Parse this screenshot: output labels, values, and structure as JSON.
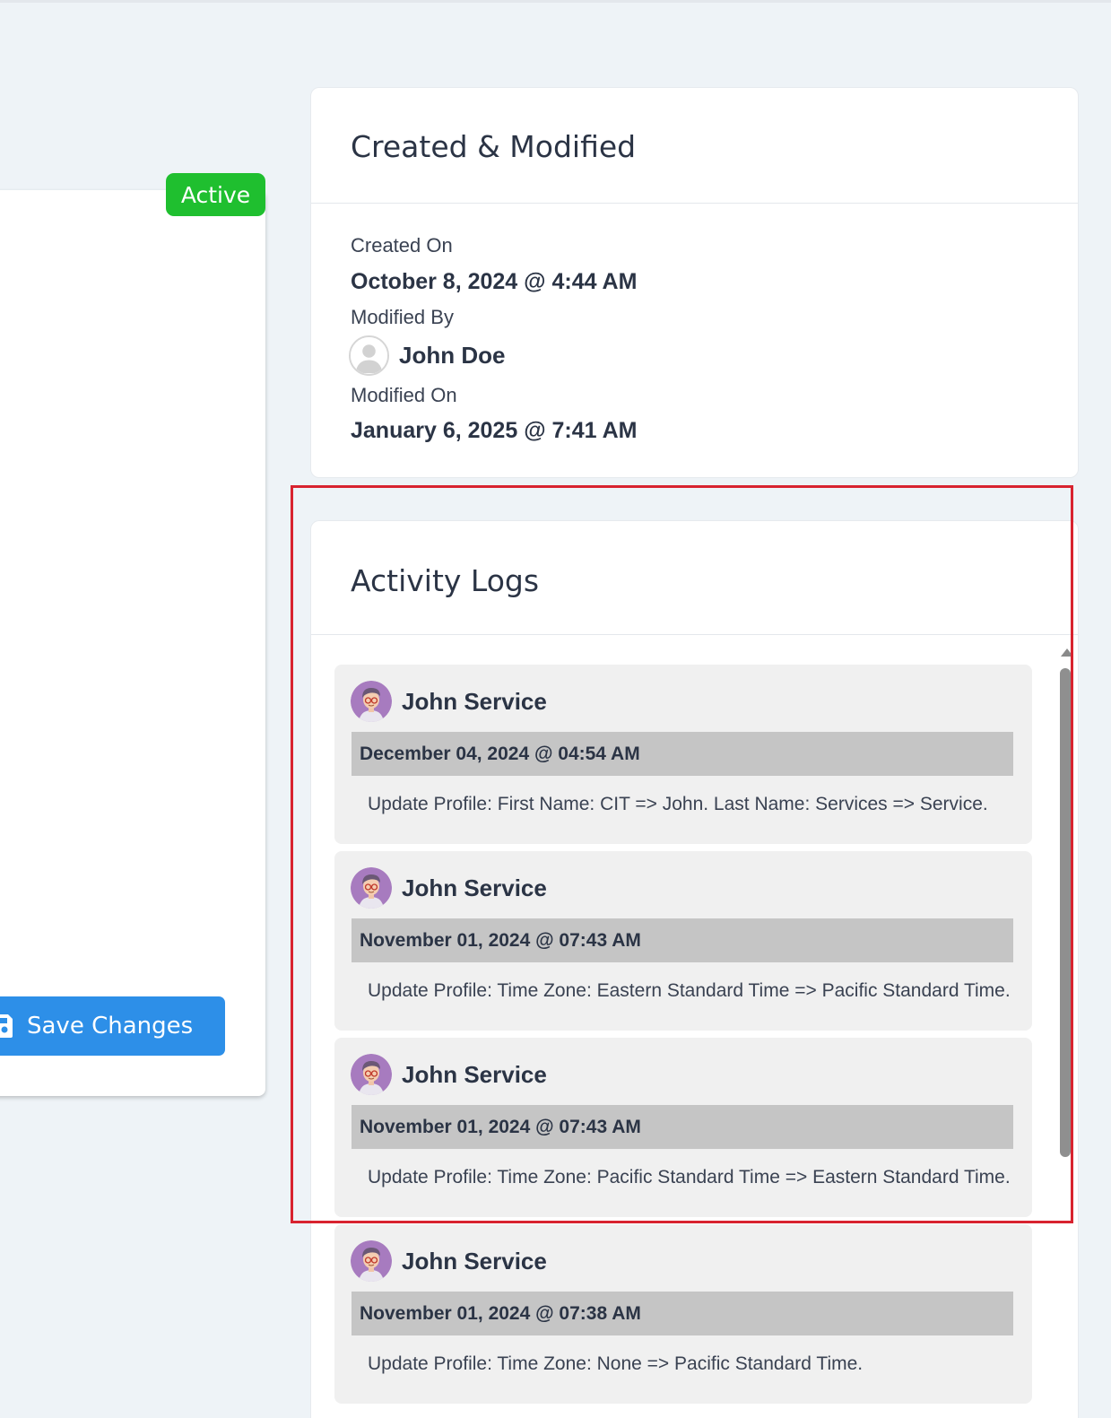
{
  "profile": {
    "status": "Active",
    "save_label": "Save Changes"
  },
  "created_modified": {
    "title": "Created & Modified",
    "created_on_label": "Created On",
    "created_on": "October 8, 2024 @ 4:44 AM",
    "modified_by_label": "Modified By",
    "modified_by": "John Doe",
    "modified_on_label": "Modified On",
    "modified_on": "January 6, 2025 @ 7:41 AM"
  },
  "activity": {
    "title": "Activity Logs",
    "logs": [
      {
        "user": "John Service",
        "date": "December 04, 2024 @ 04:54 AM",
        "text": "Update Profile: First Name: CIT => John. Last Name: Services => Service."
      },
      {
        "user": "John Service",
        "date": "November 01, 2024 @ 07:43 AM",
        "text": "Update Profile: Time Zone: Eastern Standard Time => Pacific Standard Time."
      },
      {
        "user": "John Service",
        "date": "November 01, 2024 @ 07:43 AM",
        "text": "Update Profile: Time Zone: Pacific Standard Time => Eastern Standard Time."
      },
      {
        "user": "John Service",
        "date": "November 01, 2024 @ 07:38 AM",
        "text": "Update Profile: Time Zone: None => Pacific Standard Time."
      }
    ]
  },
  "colors": {
    "status_active": "#1fbf2f",
    "primary_button": "#2d8fe8",
    "highlight": "#d8232f"
  },
  "icons": {
    "save": "save-icon",
    "user_avatar": "user-avatar-icon",
    "service_avatar": "service-avatar-icon"
  }
}
